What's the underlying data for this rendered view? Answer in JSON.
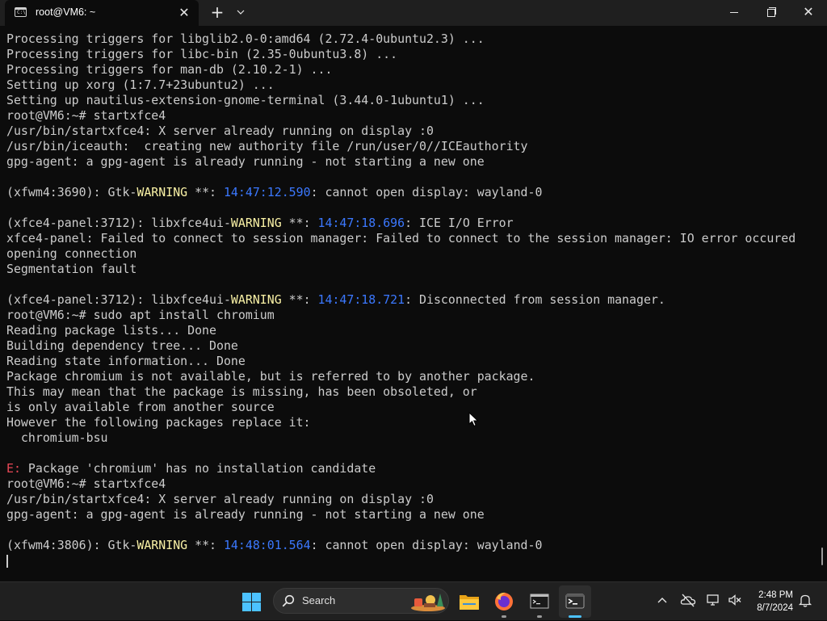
{
  "window": {
    "tab_title": "root@VM6: ~",
    "tab_icon_text": "C:\\",
    "tab_close": "✕",
    "new_tab": "+",
    "dropdown": "⌄",
    "close_glyph": "✕"
  },
  "terminal": {
    "lines": [
      [
        {
          "t": "Processing triggers for libglib2.0-0:amd64 (2.72.4-0ubuntu2.3) ..."
        }
      ],
      [
        {
          "t": "Processing triggers for libc-bin (2.35-0ubuntu3.8) ..."
        }
      ],
      [
        {
          "t": "Processing triggers for man-db (2.10.2-1) ..."
        }
      ],
      [
        {
          "t": "Setting up xorg (1:7.7+23ubuntu2) ..."
        }
      ],
      [
        {
          "t": "Setting up nautilus-extension-gnome-terminal (3.44.0-1ubuntu1) ..."
        }
      ],
      [
        {
          "t": "root@VM6:~# startxfce4"
        }
      ],
      [
        {
          "t": "/usr/bin/startxfce4: X server already running on display :0"
        }
      ],
      [
        {
          "t": "/usr/bin/iceauth:  creating new authority file /run/user/0//ICEauthority"
        }
      ],
      [
        {
          "t": "gpg-agent: a gpg-agent is already running - not starting a new one"
        }
      ],
      [],
      [
        {
          "t": "(xfwm4:3690): Gtk-"
        },
        {
          "t": "WARNING",
          "c": "warn"
        },
        {
          "t": " **: "
        },
        {
          "t": "14:47:12.590",
          "c": "ts"
        },
        {
          "t": ": cannot open display: wayland-0"
        }
      ],
      [],
      [
        {
          "t": "(xfce4-panel:3712): libxfce4ui-"
        },
        {
          "t": "WARNING",
          "c": "warn"
        },
        {
          "t": " **: "
        },
        {
          "t": "14:47:18.696",
          "c": "ts"
        },
        {
          "t": ": ICE I/O Error"
        }
      ],
      [
        {
          "t": "xfce4-panel: Failed to connect to session manager: Failed to connect to the session manager: IO error occured"
        }
      ],
      [
        {
          "t": "opening connection"
        }
      ],
      [
        {
          "t": "Segmentation fault"
        }
      ],
      [],
      [
        {
          "t": "(xfce4-panel:3712): libxfce4ui-"
        },
        {
          "t": "WARNING",
          "c": "warn"
        },
        {
          "t": " **: "
        },
        {
          "t": "14:47:18.721",
          "c": "ts"
        },
        {
          "t": ": Disconnected from session manager."
        }
      ],
      [
        {
          "t": "root@VM6:~# sudo apt install chromium"
        }
      ],
      [
        {
          "t": "Reading package lists... Done"
        }
      ],
      [
        {
          "t": "Building dependency tree... Done"
        }
      ],
      [
        {
          "t": "Reading state information... Done"
        }
      ],
      [
        {
          "t": "Package chromium is not available, but is referred to by another package."
        }
      ],
      [
        {
          "t": "This may mean that the package is missing, has been obsoleted, or"
        }
      ],
      [
        {
          "t": "is only available from another source"
        }
      ],
      [
        {
          "t": "However the following packages replace it:"
        }
      ],
      [
        {
          "t": "  chromium-bsu"
        }
      ],
      [],
      [
        {
          "t": "E:",
          "c": "err"
        },
        {
          "t": " Package 'chromium' has no installation candidate"
        }
      ],
      [
        {
          "t": "root@VM6:~# startxfce4"
        }
      ],
      [
        {
          "t": "/usr/bin/startxfce4: X server already running on display :0"
        }
      ],
      [
        {
          "t": "gpg-agent: a gpg-agent is already running - not starting a new one"
        }
      ],
      [],
      [
        {
          "t": "(xfwm4:3806): Gtk-"
        },
        {
          "t": "WARNING",
          "c": "warn"
        },
        {
          "t": " **: "
        },
        {
          "t": "14:48:01.564",
          "c": "ts"
        },
        {
          "t": ": cannot open display: wayland-0"
        }
      ]
    ]
  },
  "taskbar": {
    "search_label": "Search",
    "icons": {
      "start": "windows-start-icon",
      "explorer": "file-explorer-icon",
      "firefox": "firefox-icon",
      "cmd": "command-prompt-icon",
      "terminal": "windows-terminal-icon"
    },
    "tray": {
      "chevron": "^",
      "time": "2:48 PM",
      "date": "8/7/2024"
    }
  },
  "colors": {
    "terminal_bg": "#0c0c0c",
    "terminal_fg": "#cccccc",
    "warning": "#f9f1a5",
    "timestamp": "#3b78ff",
    "error": "#e74856",
    "accent": "#4cc2ff"
  }
}
